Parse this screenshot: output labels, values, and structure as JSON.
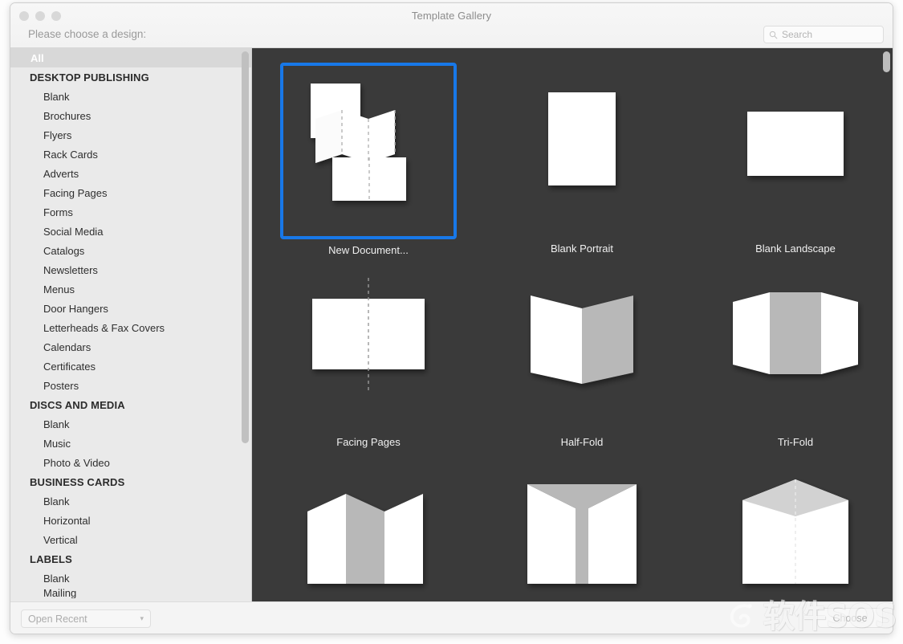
{
  "window": {
    "title": "Template Gallery",
    "prompt_label": "Please choose a design:",
    "traffic_lights": [
      "close-button",
      "minimize-button",
      "zoom-button"
    ]
  },
  "search": {
    "placeholder": "Search",
    "value": "",
    "icon": "search-icon"
  },
  "sidebar": {
    "selected": "All",
    "items": [
      {
        "type": "item",
        "label": "All",
        "selected": true
      },
      {
        "type": "header",
        "label": "DESKTOP PUBLISHING"
      },
      {
        "type": "item",
        "label": "Blank"
      },
      {
        "type": "item",
        "label": "Brochures"
      },
      {
        "type": "item",
        "label": "Flyers"
      },
      {
        "type": "item",
        "label": "Rack Cards"
      },
      {
        "type": "item",
        "label": "Adverts"
      },
      {
        "type": "item",
        "label": "Facing Pages"
      },
      {
        "type": "item",
        "label": "Forms"
      },
      {
        "type": "item",
        "label": "Social Media"
      },
      {
        "type": "item",
        "label": "Catalogs"
      },
      {
        "type": "item",
        "label": "Newsletters"
      },
      {
        "type": "item",
        "label": "Menus"
      },
      {
        "type": "item",
        "label": "Door Hangers"
      },
      {
        "type": "item",
        "label": "Letterheads & Fax Covers"
      },
      {
        "type": "item",
        "label": "Calendars"
      },
      {
        "type": "item",
        "label": "Certificates"
      },
      {
        "type": "item",
        "label": "Posters"
      },
      {
        "type": "header",
        "label": "DISCS AND MEDIA"
      },
      {
        "type": "item",
        "label": "Blank"
      },
      {
        "type": "item",
        "label": "Music"
      },
      {
        "type": "item",
        "label": "Photo & Video"
      },
      {
        "type": "header",
        "label": "BUSINESS CARDS"
      },
      {
        "type": "item",
        "label": "Blank"
      },
      {
        "type": "item",
        "label": "Horizontal"
      },
      {
        "type": "item",
        "label": "Vertical"
      },
      {
        "type": "header",
        "label": "LABELS"
      },
      {
        "type": "item",
        "label": "Blank"
      },
      {
        "type": "item",
        "label": "Mailing",
        "clipped": true
      }
    ]
  },
  "gallery": {
    "background_color": "#3a3a3a",
    "selection_color": "#1878e8",
    "rows": [
      {
        "cells": [
          {
            "label": "New Document...",
            "art": "multi-document",
            "selected": true
          },
          {
            "label": "Blank Portrait",
            "art": "page-portrait",
            "selected": false
          },
          {
            "label": "Blank Landscape",
            "art": "page-landscape",
            "selected": false
          }
        ]
      },
      {
        "cells": [
          {
            "label": "Facing Pages",
            "art": "facing-pages",
            "selected": false
          },
          {
            "label": "Half-Fold",
            "art": "half-fold",
            "selected": false
          },
          {
            "label": "Tri-Fold",
            "art": "tri-fold",
            "selected": false
          }
        ]
      },
      {
        "cells": [
          {
            "label": "",
            "art": "z-fold",
            "selected": false
          },
          {
            "label": "",
            "art": "gate-fold",
            "selected": false
          },
          {
            "label": "",
            "art": "book-fold",
            "selected": false
          }
        ]
      }
    ]
  },
  "footer": {
    "open_recent_label": "Open Recent",
    "open_recent_chevron": "chevron-down-icon",
    "choose_label": "Choose"
  },
  "watermark": {
    "text": "软件SOS",
    "icon": "swirl-logo-icon"
  }
}
